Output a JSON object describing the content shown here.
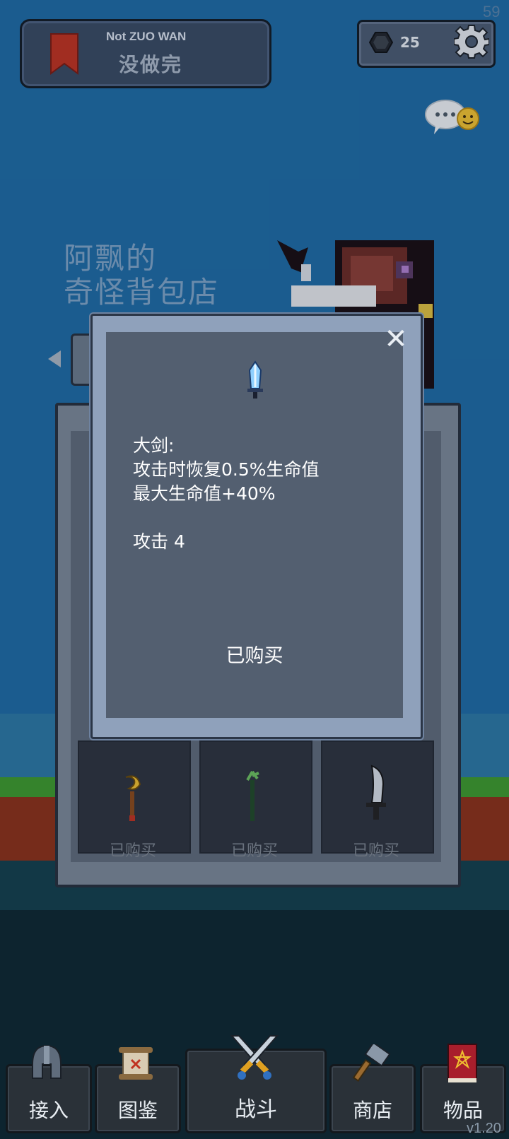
{
  "status": {
    "fps": "59",
    "version": "v1.20"
  },
  "banner": {
    "title_en": "Not ZUO WAN",
    "title_cn": "没做完"
  },
  "currency": {
    "gems": "25"
  },
  "shop": {
    "sign_line1": "阿飘的",
    "sign_line2": "奇怪背包店"
  },
  "slots": [
    {
      "label": "已购买",
      "icon": "golden-moon-staff-icon"
    },
    {
      "label": "已购买",
      "icon": "green-vine-staff-icon"
    },
    {
      "label": "已购买",
      "icon": "curved-blade-icon"
    }
  ],
  "modal": {
    "item_icon": "blue-sword-icon",
    "lines": [
      "大剑:",
      "攻击时恢复0.5%生命值",
      "最大生命值+40%",
      "",
      "攻击 4"
    ],
    "status": "已购买",
    "close": "✕"
  },
  "nav": [
    {
      "label": "接入",
      "icon": "helmet-icon"
    },
    {
      "label": "图鉴",
      "icon": "scroll-icon"
    },
    {
      "label": "战斗",
      "icon": "crossed-swords-icon"
    },
    {
      "label": "商店",
      "icon": "hammer-icon"
    },
    {
      "label": "物品",
      "icon": "spellbook-icon"
    }
  ],
  "colors": {
    "sky": "#1d6ba5",
    "panel": "#535f70",
    "accent_gem": "#2a2f36"
  }
}
